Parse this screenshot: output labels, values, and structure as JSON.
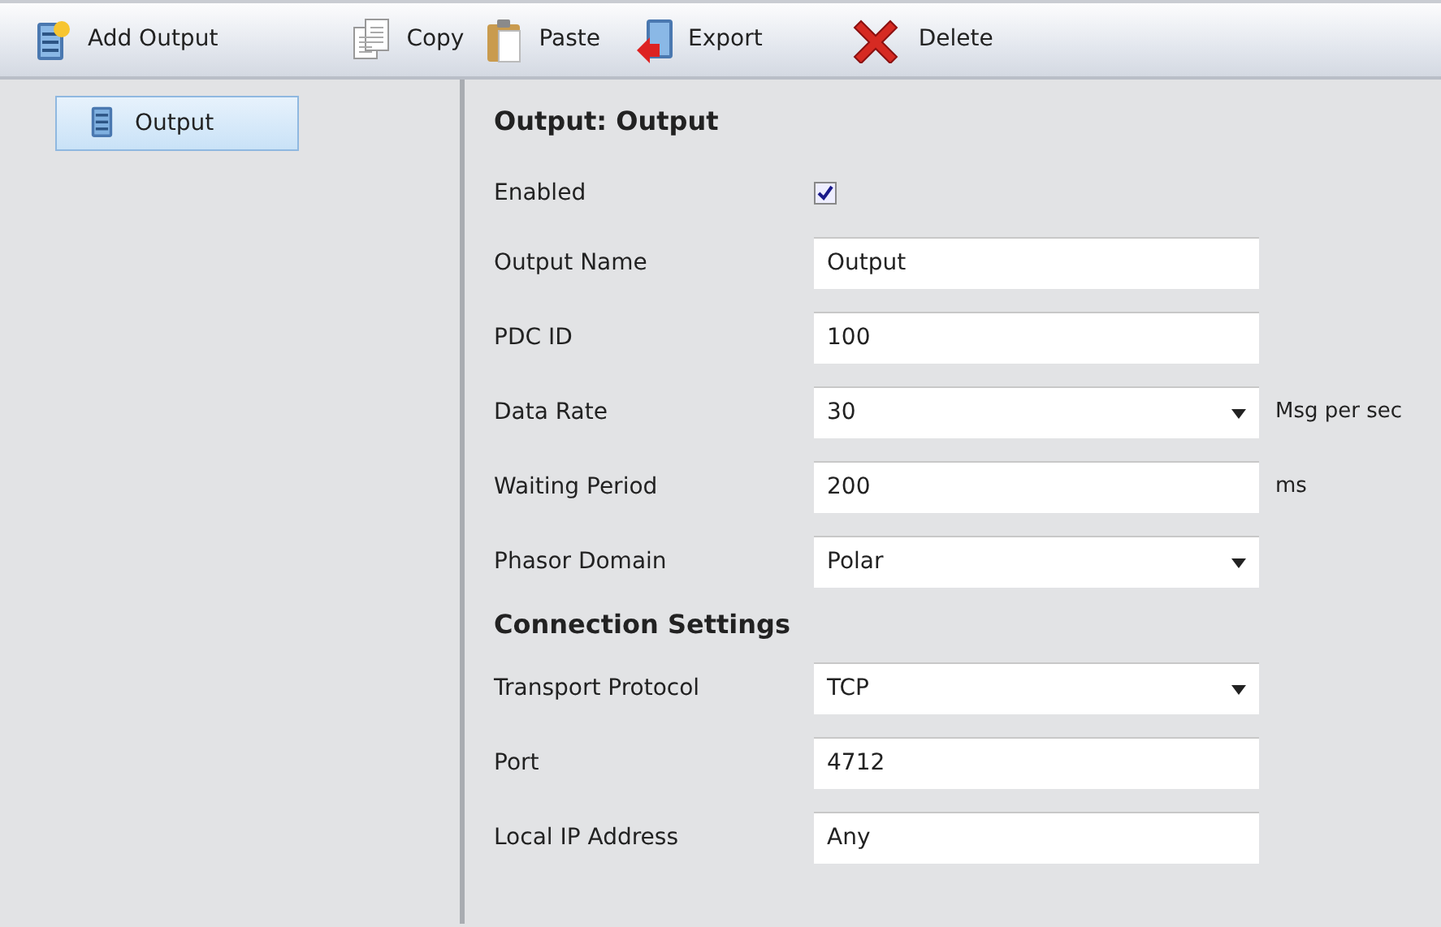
{
  "toolbar": [
    {
      "kind": "add",
      "label": "Add Output"
    },
    {
      "kind": "copy",
      "label": "Copy"
    },
    {
      "kind": "paste",
      "label": "Paste"
    },
    {
      "kind": "export",
      "label": "Export"
    },
    {
      "kind": "delete",
      "label": "Delete"
    }
  ],
  "sidebar": {
    "items": [
      {
        "label": "Output",
        "selected": true
      }
    ]
  },
  "form": {
    "title": "Output: Output",
    "sections": [
      {
        "fields": [
          {
            "kind": "checkbox",
            "label": "Enabled",
            "checked": true
          },
          {
            "kind": "text",
            "label": "Output Name",
            "value": "Output"
          },
          {
            "kind": "text",
            "label": "PDC ID",
            "value": "100"
          },
          {
            "kind": "dropdown",
            "label": "Data Rate",
            "value": "30",
            "unit": "Msg per sec"
          },
          {
            "kind": "text",
            "label": "Waiting Period",
            "value": "200",
            "unit": "ms"
          },
          {
            "kind": "dropdown",
            "label": "Phasor Domain",
            "value": "Polar"
          }
        ]
      },
      {
        "title": "Connection Settings",
        "fields": [
          {
            "kind": "dropdown",
            "label": "Transport Protocol",
            "value": "TCP"
          },
          {
            "kind": "text",
            "label": "Port",
            "value": "4712"
          },
          {
            "kind": "text",
            "label": "Local IP Address",
            "value": "Any"
          }
        ]
      }
    ]
  }
}
